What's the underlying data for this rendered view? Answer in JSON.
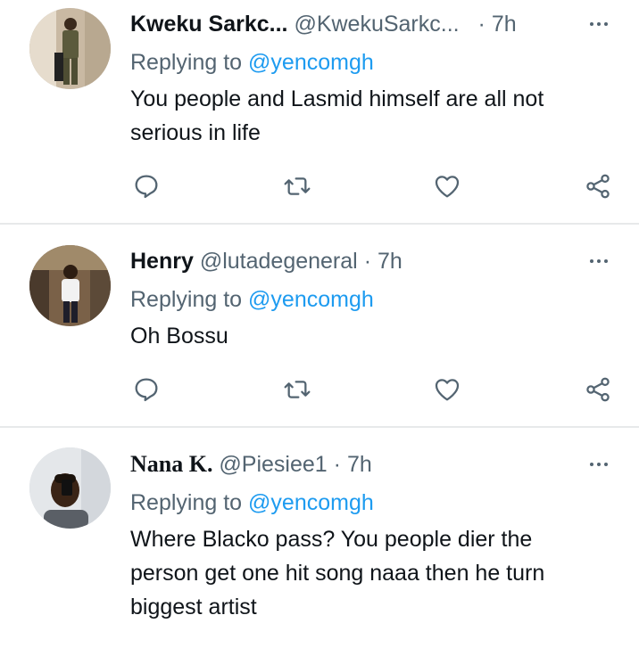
{
  "tweets": [
    {
      "name": "Kweku Sarkc...",
      "handle": "@KwekuSarkc...",
      "separator": "·",
      "time": "7h",
      "replying_prefix": "Replying to",
      "replying_to": "@yencomgh",
      "text": "You people and Lasmid himself are all not serious in life"
    },
    {
      "name": "Henry",
      "handle": "@lutadegeneral",
      "separator": "·",
      "time": "7h",
      "replying_prefix": "Replying to",
      "replying_to": "@yencomgh",
      "text": "Oh Bossu"
    },
    {
      "name": "Nana K.",
      "handle": "@Piesiee1",
      "separator": "·",
      "time": "7h",
      "replying_prefix": "Replying to",
      "replying_to": "@yencomgh",
      "text": "Where Blacko pass? You people dier the person get one hit song naaa then he turn biggest artist"
    }
  ],
  "icons": {
    "more": "more-dots-icon",
    "reply": "reply-bubble-icon",
    "retweet": "retweet-icon",
    "like": "heart-icon",
    "share": "share-icon"
  },
  "colors": {
    "text": "#0f1419",
    "secondary": "#536471",
    "mention": "#1d9bf0",
    "divider": "#e7e9ea"
  }
}
